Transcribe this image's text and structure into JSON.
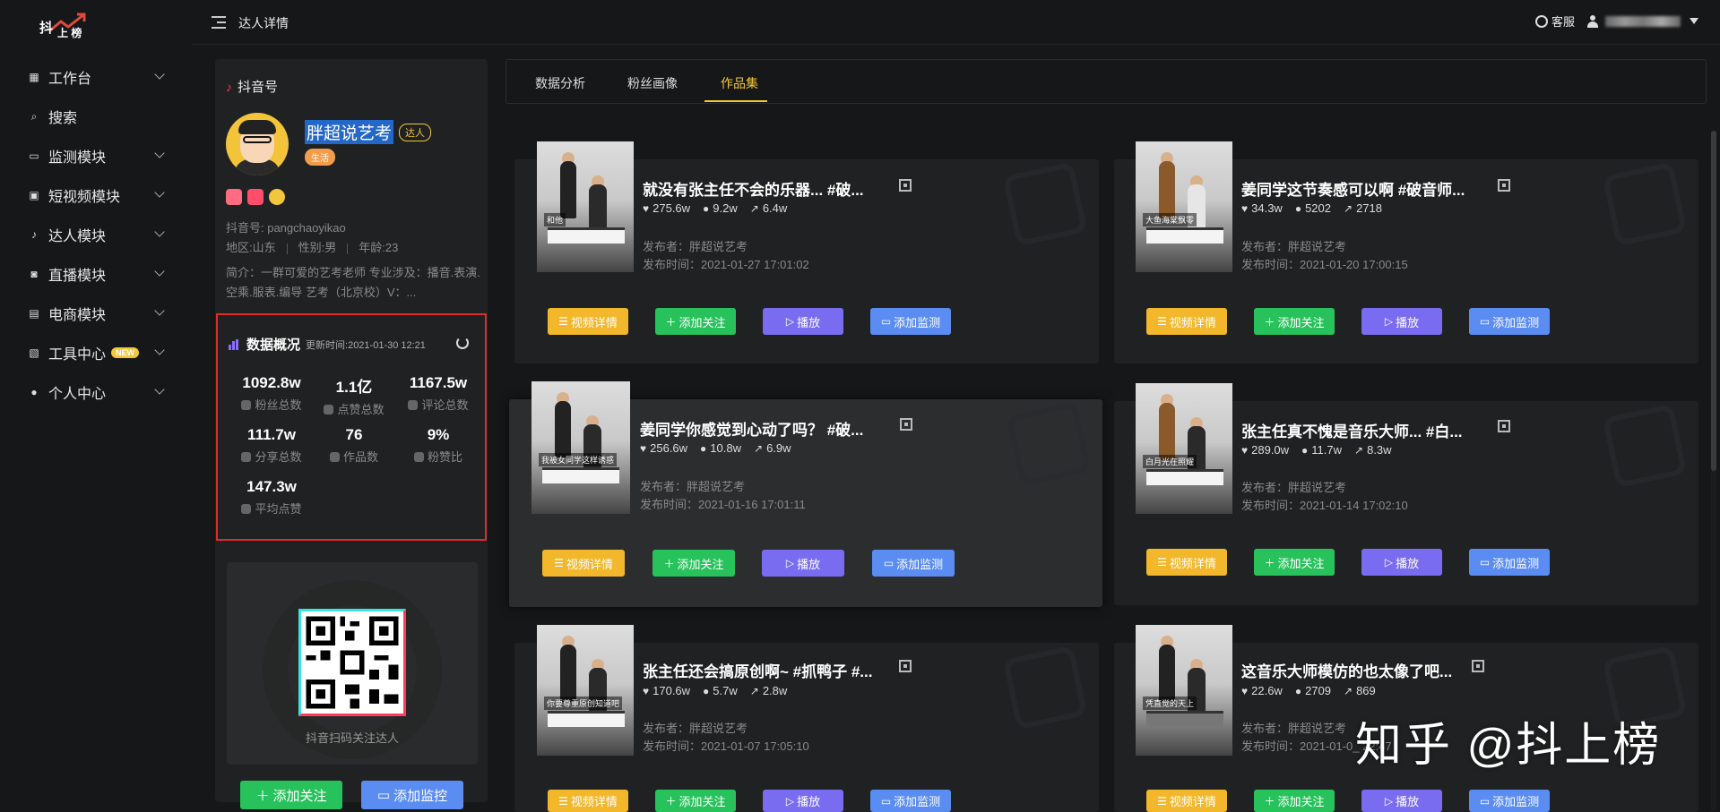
{
  "sidebar": {
    "items": [
      {
        "label": "工作台",
        "icon": "grid-icon",
        "chevron": true
      },
      {
        "label": "搜索",
        "icon": "search-icon",
        "chevron": false
      },
      {
        "label": "监测模块",
        "icon": "monitor-icon",
        "chevron": true
      },
      {
        "label": "短视频模块",
        "icon": "video-icon",
        "chevron": true
      },
      {
        "label": "达人模块",
        "icon": "tiktok-icon",
        "chevron": true
      },
      {
        "label": "直播模块",
        "icon": "live-icon",
        "chevron": true
      },
      {
        "label": "电商模块",
        "icon": "shop-icon",
        "chevron": true
      },
      {
        "label": "工具中心",
        "icon": "tool-icon",
        "chevron": true,
        "badge": "NEW"
      },
      {
        "label": "个人中心",
        "icon": "user-icon",
        "chevron": true
      }
    ],
    "logo_top": "抖",
    "logo_bottom": "上 榜"
  },
  "topbar": {
    "title": "达人详情",
    "service": "客服"
  },
  "profile": {
    "section_title": "抖音号",
    "name": "胖超说艺考",
    "badge_daren": "达人",
    "badge_category": "生活",
    "douyin_id": "抖音号: pangchaoyikao",
    "region": "地区:山东",
    "gender": "性别:男",
    "age": "年龄:23",
    "bio": "简介：一群可爱的艺考老师 专业涉及：播音.表演.空乘.服表.编导 艺考（北京校）V：..."
  },
  "stats": {
    "title": "数据概况",
    "updated": "更新时间:2021-01-30 12:21",
    "items": [
      {
        "value": "1092.8w",
        "label": "粉丝总数"
      },
      {
        "value": "1.1亿",
        "label": "点赞总数"
      },
      {
        "value": "1167.5w",
        "label": "评论总数"
      },
      {
        "value": "111.7w",
        "label": "分享总数"
      },
      {
        "value": "76",
        "label": "作品数"
      },
      {
        "value": "9%",
        "label": "粉赞比"
      },
      {
        "value": "147.3w",
        "label": "平均点赞"
      }
    ]
  },
  "qr_card": {
    "label": "抖音扫码关注达人",
    "follow_button": "添加关注",
    "monitor_button": "添加监控"
  },
  "tabs": [
    {
      "label": "数据分析",
      "active": false
    },
    {
      "label": "粉丝画像",
      "active": false
    },
    {
      "label": "作品集",
      "active": true
    }
  ],
  "buttons": {
    "detail": "视频详情",
    "follow": "添加关注",
    "play": "播放",
    "monitor": "添加监测"
  },
  "works": [
    {
      "title": "就没有张主任不会的乐器... #破...",
      "likes": "275.6w",
      "comments": "9.2w",
      "shares": "6.4w",
      "publisher": "发布者：胖超说艺考",
      "time": "发布时间：2021-01-27 17:01:02",
      "caption": "和他 "
    },
    {
      "title": "姜同学这节奏感可以啊 #破音师...",
      "likes": "34.3w",
      "comments": "5202",
      "shares": "2718",
      "publisher": "发布者：胖超说艺考",
      "time": "发布时间：2021-01-20 17:00:15",
      "caption": "大鱼海棠飘零"
    },
    {
      "title": "姜同学你感觉到心动了吗？ #破...",
      "likes": "256.6w",
      "comments": "10.8w",
      "shares": "6.9w",
      "publisher": "发布者：胖超说艺考",
      "time": "发布时间：2021-01-16 17:01:11",
      "caption": "我被女同学这样诱惑"
    },
    {
      "title": "张主任真不愧是音乐大师... #白...",
      "likes": "289.0w",
      "comments": "11.7w",
      "shares": "8.3w",
      "publisher": "发布者：胖超说艺考",
      "time": "发布时间：2021-01-14 17:02:10",
      "caption": "白月光在照耀"
    },
    {
      "title": "张主任还会搞原创啊~ #抓鸭子 #...",
      "likes": "170.6w",
      "comments": "5.7w",
      "shares": "2.8w",
      "publisher": "发布者：胖超说艺考",
      "time": "发布时间：2021-01-07 17:05:10",
      "caption": "你要尊重原创知道吧"
    },
    {
      "title": "这音乐大师模仿的也太像了吧...",
      "likes": "22.6w",
      "comments": "2709",
      "shares": "869",
      "publisher": "发布者：胖超说艺考",
      "time": "发布时间：2021-01-0_ 22:47",
      "caption": "凭直觉的天上"
    }
  ],
  "watermark": "知乎 @抖上榜"
}
